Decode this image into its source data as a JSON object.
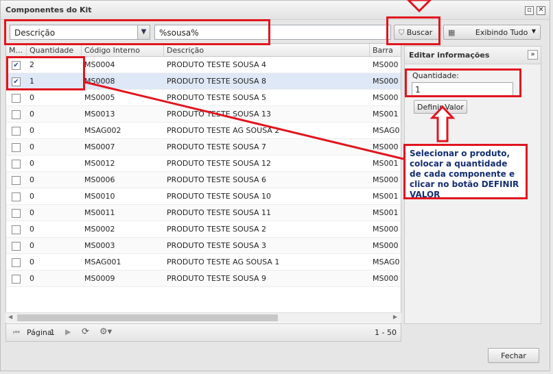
{
  "window": {
    "title": "Componentes do Kit"
  },
  "toolbar": {
    "filter_field": "Descrição",
    "search_value": "%sousa%",
    "search_button": "Buscar",
    "display_button": "Exibindo Tudo"
  },
  "grid": {
    "columns": [
      "M...",
      "Quantidade",
      "Código Interno",
      "Descrição",
      "Barra"
    ],
    "rows": [
      {
        "checked": true,
        "qty": "2",
        "code": "MS0004",
        "desc": "PRODUTO TESTE SOUSA 4",
        "bar": "MS000"
      },
      {
        "checked": true,
        "qty": "1",
        "code": "MS0008",
        "desc": "PRODUTO TESTE SOUSA 8",
        "bar": "MS000"
      },
      {
        "checked": false,
        "qty": "0",
        "code": "MS0005",
        "desc": "PRODUTO TESTE SOUSA 5",
        "bar": "MS000"
      },
      {
        "checked": false,
        "qty": "0",
        "code": "MS0013",
        "desc": "PRODUTO TESTE SOUSA 13",
        "bar": "MS001"
      },
      {
        "checked": false,
        "qty": "0",
        "code": "MSAG002",
        "desc": "PRODUTO TESTE AG SOUSA 2",
        "bar": "MSAG0"
      },
      {
        "checked": false,
        "qty": "0",
        "code": "MS0007",
        "desc": "PRODUTO TESTE SOUSA 7",
        "bar": "MS000"
      },
      {
        "checked": false,
        "qty": "0",
        "code": "MS0012",
        "desc": "PRODUTO TESTE SOUSA 12",
        "bar": "MS001"
      },
      {
        "checked": false,
        "qty": "0",
        "code": "MS0006",
        "desc": "PRODUTO TESTE SOUSA 6",
        "bar": "MS000"
      },
      {
        "checked": false,
        "qty": "0",
        "code": "MS0010",
        "desc": "PRODUTO TESTE SOUSA 10",
        "bar": "MS001"
      },
      {
        "checked": false,
        "qty": "0",
        "code": "MS0011",
        "desc": "PRODUTO TESTE SOUSA 11",
        "bar": "MS001"
      },
      {
        "checked": false,
        "qty": "0",
        "code": "MS0002",
        "desc": "PRODUTO TESTE SOUSA 2",
        "bar": "MS000"
      },
      {
        "checked": false,
        "qty": "0",
        "code": "MS0003",
        "desc": "PRODUTO TESTE SOUSA 3",
        "bar": "MS000"
      },
      {
        "checked": false,
        "qty": "0",
        "code": "MSAG001",
        "desc": "PRODUTO TESTE AG SOUSA 1",
        "bar": "MSAG0"
      },
      {
        "checked": false,
        "qty": "0",
        "code": "MS0009",
        "desc": "PRODUTO TESTE SOUSA 9",
        "bar": "MS000"
      }
    ],
    "selected_row": 1
  },
  "pager": {
    "page_label": "Página",
    "page_value": "1",
    "range": "1 - 50"
  },
  "edit_panel": {
    "title": "Editar informações",
    "qty_label": "Quantidade:",
    "qty_value": "1",
    "define_button": "Definir Valor"
  },
  "annotation": {
    "text": "Selecionar o produto, colocar a quantidade de cada componente e clicar no botão DEFINIR VALOR",
    "color": "#e1141e"
  },
  "footer": {
    "close_button": "Fechar"
  }
}
